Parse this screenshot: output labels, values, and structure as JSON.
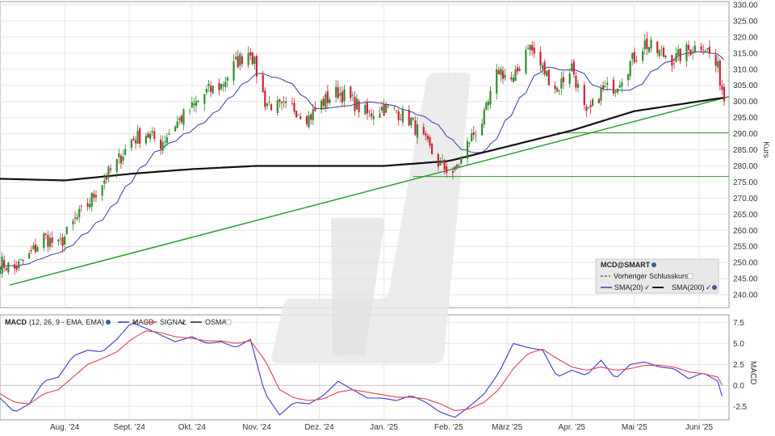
{
  "chart_data": [
    {
      "type": "candlestick",
      "ylabel": "Kurs",
      "ylim": [
        236,
        331
      ],
      "ytick_values": [
        240,
        245,
        250,
        255,
        260,
        265,
        270,
        275,
        280,
        285,
        290,
        295,
        300,
        305,
        310,
        315,
        320,
        325,
        330
      ],
      "ytick_labels": [
        "240.00",
        "245.00",
        "250.00",
        "255.00",
        "260.00",
        "265.00",
        "270.00",
        "275.00",
        "280.00",
        "285.00",
        "290.00",
        "295.00",
        "300.00",
        "305.00",
        "310.00",
        "315.00",
        "320.00",
        "325.00",
        "330.00"
      ],
      "x_labels": [
        "Aug. '24",
        "Sept. '24",
        "Okt. '24",
        "Nov. '24",
        "Dez. '24",
        "Jan. '25",
        "Feb. '25",
        "März '25",
        "Apr. '25",
        "Mai '25",
        "Juni '25"
      ],
      "x_label_dates": [
        "2024-08-01",
        "2024-09-01",
        "2024-10-01",
        "2024-11-01",
        "2024-12-01",
        "2025-01-01",
        "2025-02-01",
        "2025-03-01",
        "2025-04-01",
        "2025-05-01",
        "2025-06-01"
      ],
      "x_range": [
        "2024-07-01",
        "2025-06-13"
      ],
      "grid": true,
      "legend": {
        "title": "MCD@SMART",
        "entries": [
          "Vorheriger Schlusskurs",
          "SMA(20)",
          "SMA(200)"
        ],
        "position": "bottom-right"
      },
      "close_anchors": {
        "dates": [
          "2024-07-01",
          "2024-07-08",
          "2024-07-15",
          "2024-07-22",
          "2024-07-29",
          "2024-08-05",
          "2024-08-12",
          "2024-08-19",
          "2024-08-26",
          "2024-09-02",
          "2024-09-09",
          "2024-09-16",
          "2024-09-23",
          "2024-10-01",
          "2024-10-08",
          "2024-10-15",
          "2024-10-22",
          "2024-10-29",
          "2024-11-05",
          "2024-11-12",
          "2024-11-19",
          "2024-11-26",
          "2024-12-03",
          "2024-12-10",
          "2024-12-17",
          "2024-12-24",
          "2024-12-31",
          "2025-01-07",
          "2025-01-14",
          "2025-01-21",
          "2025-01-28",
          "2025-02-04",
          "2025-02-11",
          "2025-02-18",
          "2025-02-25",
          "2025-03-04",
          "2025-03-11",
          "2025-03-18",
          "2025-03-25",
          "2025-04-01",
          "2025-04-08",
          "2025-04-15",
          "2025-04-22",
          "2025-04-29",
          "2025-05-06",
          "2025-05-13",
          "2025-05-20",
          "2025-05-27",
          "2025-06-03",
          "2025-06-10",
          "2025-06-13"
        ],
        "values": [
          250,
          248,
          252,
          258,
          255,
          262,
          268,
          275,
          281,
          288,
          290,
          287,
          293,
          298,
          303,
          305,
          312,
          316,
          300,
          298,
          298,
          295,
          300,
          303,
          300,
          296,
          298,
          297,
          294,
          287,
          280,
          278,
          288,
          295,
          310,
          306,
          318,
          310,
          304,
          311,
          295,
          303,
          305,
          312,
          318,
          315,
          313,
          316,
          318,
          310,
          301
        ]
      },
      "reference_lines": [
        {
          "name": "Trendlinie",
          "from": [
            "2024-07-01",
            243
          ],
          "to": [
            "2025-06-13",
            301.5
          ],
          "color": "#2e9c2e"
        },
        {
          "name": "Unterstützung",
          "value": 290.3,
          "from_date": "2025-03-25",
          "color": "#2e9c2e"
        },
        {
          "name": "Unterstützung",
          "value": 276.7,
          "from_date": "2025-01-15",
          "color": "#2e9c2e"
        }
      ],
      "previous_close": 301.0,
      "colors": {
        "up": "#2e8b2e",
        "down": "#cc2233",
        "sma20": "#3a3aa8",
        "sma200": "#111111"
      }
    },
    {
      "type": "line",
      "title": "MACD",
      "params": "(12, 26, 9 - EMA, EMA)",
      "ylabel": "MACD",
      "ylim": [
        -4.1,
        8.4
      ],
      "ytick_values": [
        7.5,
        5.0,
        2.5,
        0.0,
        -2.5
      ],
      "ytick_labels": [
        "7.5",
        "5.0",
        "2.5",
        "0.0",
        "-2.5"
      ],
      "series": [
        {
          "name": "MACD",
          "color": "#3a3ad0",
          "dates": [
            "2024-07-01",
            "2024-07-08",
            "2024-07-15",
            "2024-07-22",
            "2024-07-29",
            "2024-08-05",
            "2024-08-12",
            "2024-08-19",
            "2024-08-26",
            "2024-09-02",
            "2024-09-09",
            "2024-09-16",
            "2024-09-23",
            "2024-10-01",
            "2024-10-08",
            "2024-10-15",
            "2024-10-22",
            "2024-10-29",
            "2024-11-05",
            "2024-11-12",
            "2024-11-19",
            "2024-11-26",
            "2024-12-03",
            "2024-12-10",
            "2024-12-17",
            "2024-12-24",
            "2024-12-31",
            "2025-01-07",
            "2025-01-14",
            "2025-01-21",
            "2025-01-28",
            "2025-02-04",
            "2025-02-11",
            "2025-02-18",
            "2025-02-25",
            "2025-03-04",
            "2025-03-11",
            "2025-03-18",
            "2025-03-25",
            "2025-04-01",
            "2025-04-08",
            "2025-04-15",
            "2025-04-22",
            "2025-04-29",
            "2025-05-06",
            "2025-05-13",
            "2025-05-20",
            "2025-05-27",
            "2025-06-03",
            "2025-06-10",
            "2025-06-13"
          ],
          "values": [
            -1.5,
            -3.2,
            -2.2,
            0.5,
            1.0,
            3.5,
            4.2,
            4.0,
            5.5,
            7.5,
            6.8,
            6.0,
            5.2,
            5.8,
            5.0,
            5.2,
            4.5,
            5.5,
            -1.0,
            -3.5,
            -2.0,
            -2.2,
            -1.2,
            0.5,
            -0.5,
            -1.5,
            -1.5,
            -1.8,
            -1.2,
            -2.0,
            -3.2,
            -3.8,
            -2.5,
            -1.0,
            1.5,
            5.0,
            4.5,
            4.2,
            1.0,
            1.8,
            1.2,
            3.0,
            0.8,
            2.5,
            2.8,
            2.2,
            2.0,
            0.8,
            1.5,
            0.5,
            -2.2
          ]
        },
        {
          "name": "SIGNAL",
          "color": "#e04050",
          "dates": [
            "2024-07-01",
            "2024-07-08",
            "2024-07-15",
            "2024-07-22",
            "2024-07-29",
            "2024-08-05",
            "2024-08-12",
            "2024-08-19",
            "2024-08-26",
            "2024-09-02",
            "2024-09-09",
            "2024-09-16",
            "2024-09-23",
            "2024-10-01",
            "2024-10-08",
            "2024-10-15",
            "2024-10-22",
            "2024-10-29",
            "2024-11-05",
            "2024-11-12",
            "2024-11-19",
            "2024-11-26",
            "2024-12-03",
            "2024-12-10",
            "2024-12-17",
            "2024-12-24",
            "2024-12-31",
            "2025-01-07",
            "2025-01-14",
            "2025-01-21",
            "2025-01-28",
            "2025-02-04",
            "2025-02-11",
            "2025-02-18",
            "2025-02-25",
            "2025-03-04",
            "2025-03-11",
            "2025-03-18",
            "2025-03-25",
            "2025-04-01",
            "2025-04-08",
            "2025-04-15",
            "2025-04-22",
            "2025-04-29",
            "2025-05-06",
            "2025-05-13",
            "2025-05-20",
            "2025-05-27",
            "2025-06-03",
            "2025-06-10",
            "2025-06-13"
          ],
          "values": [
            -1.0,
            -2.0,
            -2.2,
            -1.0,
            -0.5,
            1.0,
            2.5,
            3.2,
            4.0,
            5.5,
            6.5,
            6.3,
            5.8,
            5.6,
            5.3,
            5.3,
            5.0,
            5.3,
            3.0,
            -0.5,
            -1.5,
            -1.8,
            -1.6,
            -0.8,
            -0.5,
            -0.8,
            -1.1,
            -1.4,
            -1.4,
            -1.6,
            -2.2,
            -3.0,
            -2.8,
            -2.0,
            -0.5,
            2.0,
            3.8,
            4.3,
            3.2,
            2.2,
            1.8,
            2.2,
            1.8,
            2.0,
            2.4,
            2.4,
            2.2,
            1.6,
            1.4,
            1.0,
            -0.4
          ]
        },
        {
          "name": "OSMA",
          "color": "#333333",
          "dates": [],
          "values": []
        }
      ],
      "x_range": [
        "2024-07-01",
        "2025-06-13"
      ],
      "grid": true,
      "legend_position": "top-left"
    }
  ]
}
